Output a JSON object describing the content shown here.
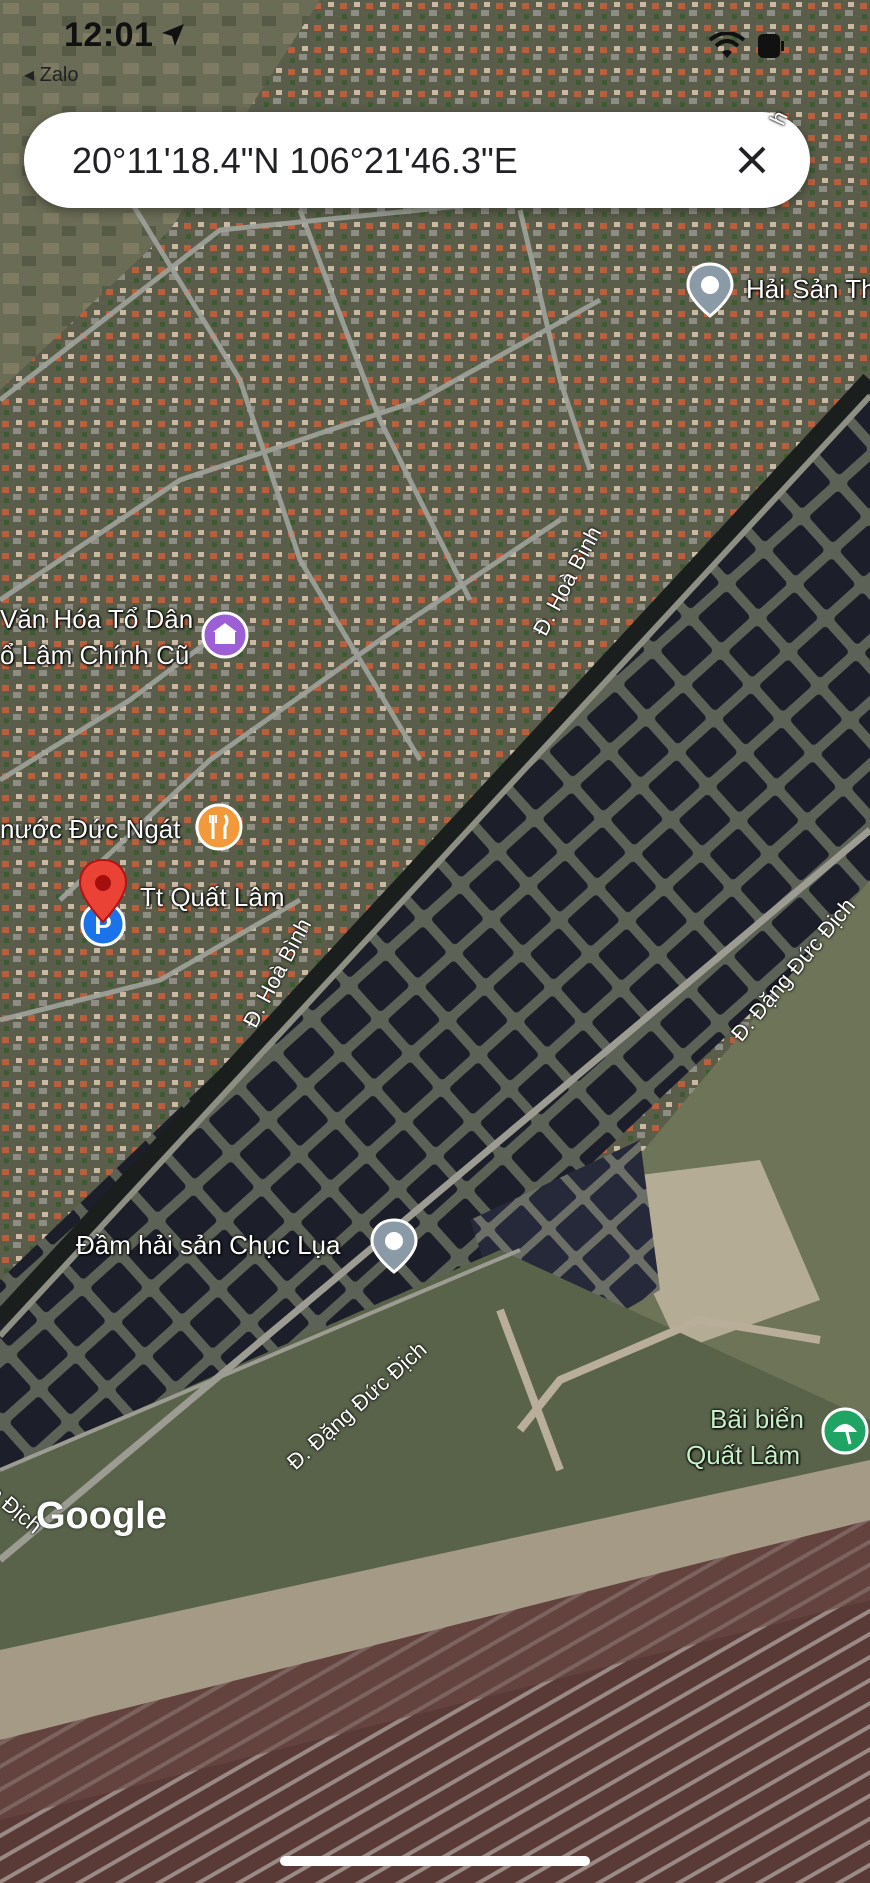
{
  "status_bar": {
    "time": "12:01",
    "back_app": "◂ Zalo"
  },
  "search": {
    "coordinates": "20°11'18.4\"N 106°21'46.3\"E"
  },
  "places": {
    "hai_san": "Hải Sản Th",
    "van_hoa_line1": "Văn Hóa Tổ Dân",
    "van_hoa_line2": "ổ Lâm Chính Cũ",
    "duc_ngat": "nước Đức Ngát",
    "tt_quat_lam": "Tt Quất Lâm",
    "dam_hai_san": "Đầm hải sản Chục Lụa",
    "bai_bien_line1": "Bãi biển",
    "bai_bien_line2": "Quất Lâm"
  },
  "roads": {
    "hoa_binh_upper": "Đ. Hoà Bình",
    "hoa_binh_lower": "Đ. Hoà Bình",
    "dang_duc_dich_right": "Đ. Đặng Đức Địch",
    "dang_duc_dich_lower": "Đ. Đặng Đức Địch",
    "dang_duc_dich_corner": "c Địch",
    "top_right_fragment": "h"
  },
  "attribution": "Google",
  "colors": {
    "pin_red": "#ea4335",
    "place_grey": "#8a9aa6",
    "attraction_purple": "#9c5fd6",
    "food_orange": "#f29a3b",
    "beach_green": "#1fa463"
  }
}
